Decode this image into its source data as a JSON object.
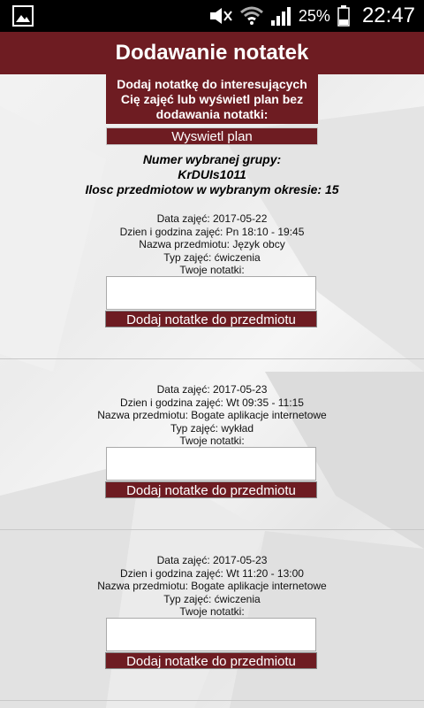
{
  "status_bar": {
    "battery_percent": "25%",
    "time": "22:47",
    "icons": [
      "gallery-icon",
      "mute-icon",
      "wifi-icon",
      "signal-icon",
      "battery-icon"
    ]
  },
  "app_bar": {
    "title": "Dodawanie notatek"
  },
  "intro": {
    "text": "Dodaj notatkę do interesujących Cię zajęć lub wyświetl plan bez dodawania notatki:",
    "show_plan_label": "Wyswietl plan"
  },
  "group": {
    "line1": "Numer wybranej grupy:",
    "line2": "KrDUIs1011",
    "line3": "Ilosc przedmiotow w wybranym okresie: 15"
  },
  "entries": [
    {
      "date": "Data zajęć: 2017-05-22",
      "day_time": "Dzien i godzina zajęć: Pn 18:10 - 19:45",
      "subject": "Nazwa przedmiotu: Język obcy",
      "type": "Typ zajęć: ćwiczenia",
      "notes_label": "Twoje notatki:",
      "button_label": "Dodaj notatke do przedmiotu"
    },
    {
      "date": "Data zajęć: 2017-05-23",
      "day_time": "Dzien i godzina zajęć: Wt 09:35 - 11:15",
      "subject": "Nazwa przedmiotu: Bogate aplikacje internetowe",
      "type": "Typ zajęć: wykład",
      "notes_label": "Twoje notatki:",
      "button_label": "Dodaj notatke do przedmiotu"
    },
    {
      "date": "Data zajęć: 2017-05-23",
      "day_time": "Dzien i godzina zajęć: Wt 11:20 - 13:00",
      "subject": "Nazwa przedmiotu: Bogate aplikacje internetowe",
      "type": "Typ zajęć: ćwiczenia",
      "notes_label": "Twoje notatki:",
      "button_label": "Dodaj notatke do przedmiotu"
    }
  ],
  "colors": {
    "primary": "#6e1c22",
    "status_bar": "#000000"
  }
}
